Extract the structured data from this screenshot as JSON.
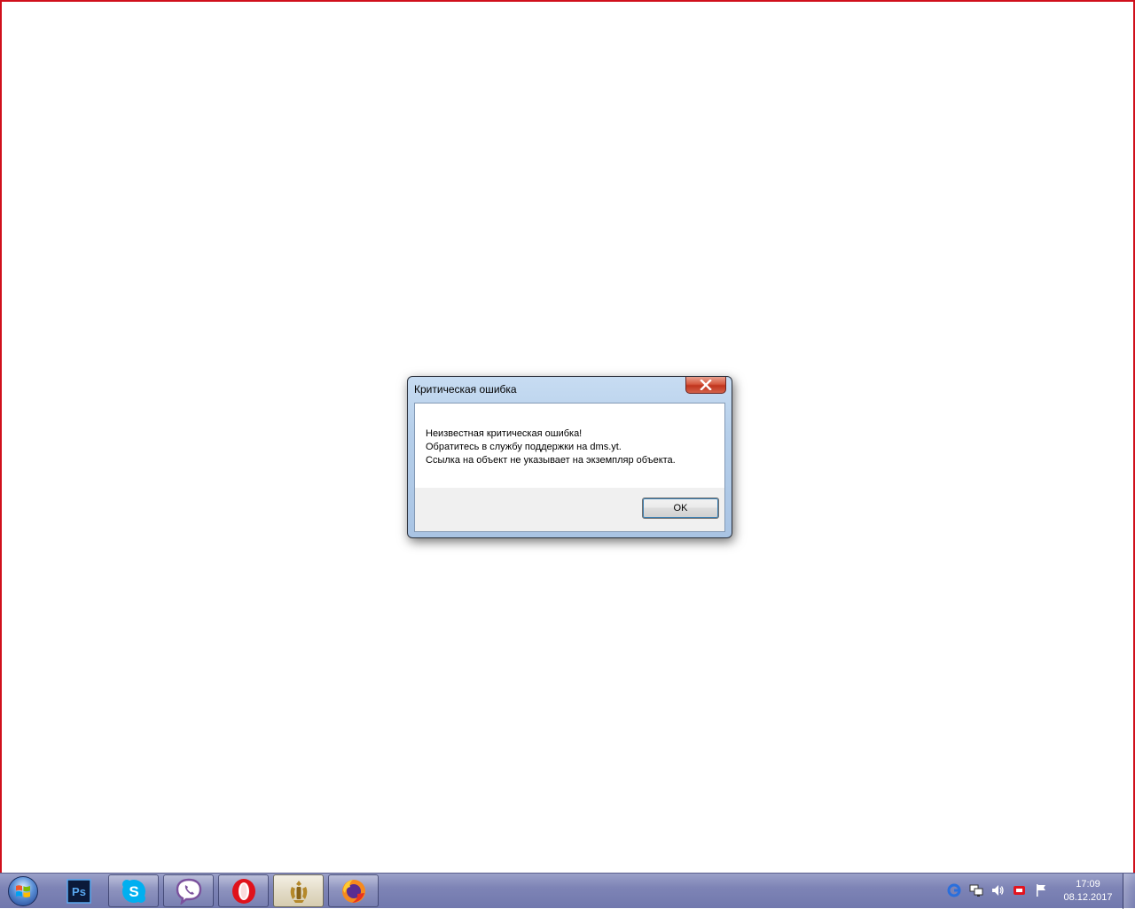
{
  "dialog": {
    "title": "Критическая ошибка",
    "close_icon": "close-icon",
    "message": {
      "line1": "Неизвестная критическая ошибка!",
      "line2": "Обратитесь в службу поддержки на dms.yt.",
      "line3": "Ссылка на объект не указывает на экземпляр объекта."
    },
    "ok_label": "OK"
  },
  "taskbar": {
    "start_icon": "windows-start-icon",
    "apps": [
      {
        "name": "photoshop",
        "label": "Ps"
      },
      {
        "name": "skype",
        "label": "S"
      },
      {
        "name": "viber"
      },
      {
        "name": "opera"
      },
      {
        "name": "emblem-app"
      },
      {
        "name": "firefox"
      }
    ],
    "tray_icons": [
      "google-update-icon",
      "network-icon",
      "volume-icon",
      "antivirus-icon",
      "action-center-flag-icon"
    ],
    "clock": {
      "time": "17:09",
      "date": "08.12.2017"
    }
  },
  "colors": {
    "frame_border": "#d0101c",
    "taskbar": "#7e84b6",
    "close_button": "#c7432b"
  }
}
